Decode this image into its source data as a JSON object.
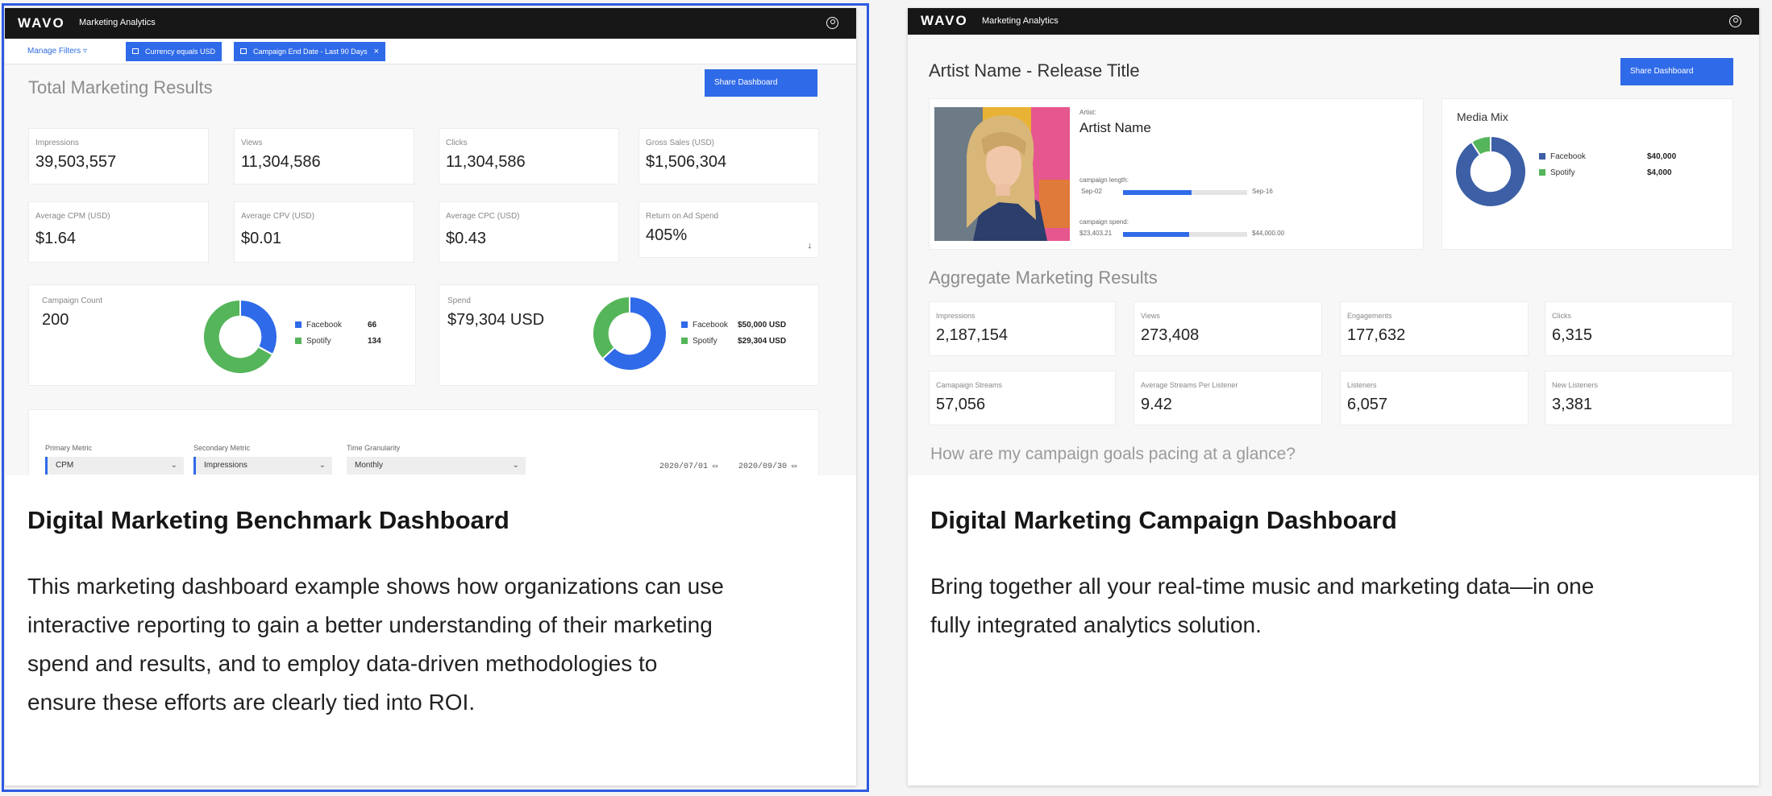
{
  "colors": {
    "accent": "#2f6ae8",
    "topbar": "#171717",
    "facebook": "#2f6ae8",
    "spotify": "#55b55a",
    "facebook_dark": "#3c5fa6"
  },
  "card1": {
    "topbar": {
      "logo": "WAVO",
      "app": "Marketing Analytics"
    },
    "filters": {
      "manage": "Manage Filters",
      "chip1": "Currency equals USD",
      "chip2": "Campaign End Date - Last 90 Days",
      "close": "×"
    },
    "title": "Total Marketing Results",
    "share": "Share Dashboard",
    "metrics": [
      {
        "label": "Impressions",
        "value": "39,503,557"
      },
      {
        "label": "Views",
        "value": "11,304,586"
      },
      {
        "label": "Clicks",
        "value": "11,304,586"
      },
      {
        "label": "Gross Sales (USD)",
        "value": "$1,506,304"
      },
      {
        "label": "Average CPM (USD)",
        "value": "$1.64"
      },
      {
        "label": "Average CPV (USD)",
        "value": "$0.01"
      },
      {
        "label": "Average CPC (USD)",
        "value": "$0.43"
      },
      {
        "label": "Return on Ad Spend",
        "value": "405%"
      }
    ],
    "roas_arrow": "↓",
    "campaign_count": {
      "label": "Campaign Count",
      "value": "200",
      "legend": [
        {
          "name": "Facebook",
          "value": "66"
        },
        {
          "name": "Spotify",
          "value": "134"
        }
      ],
      "slices": [
        66,
        134
      ]
    },
    "spend": {
      "label": "Spend",
      "value": "$79,304 USD",
      "legend": [
        {
          "name": "Facebook",
          "value": "$50,000 USD"
        },
        {
          "name": "Spotify",
          "value": "$29,304 USD"
        }
      ],
      "slices": [
        50000,
        29304
      ]
    },
    "selectors": {
      "primary_label": "Primary Metric",
      "primary_value": "CPM",
      "secondary_label": "Secondary Metric",
      "secondary_value": "Impressions",
      "time_label": "Time Granularity",
      "time_value": "Monthly",
      "date_start": "2020/07/01",
      "date_end": "2020/09/30"
    },
    "caption_title": "Digital Marketing Benchmark Dashboard",
    "caption_desc_lines": [
      "This marketing dashboard example shows how organizations can use",
      "interactive reporting to gain a better understanding of their marketing",
      "spend and results, and to employ data-driven methodologies to",
      "ensure these efforts are clearly tied into ROI."
    ]
  },
  "card2": {
    "topbar": {
      "logo": "WAVO",
      "app": "Marketing Analytics"
    },
    "title": "Artist Name - Release Title",
    "share": "Share Dashboard",
    "artist": {
      "label": "Artist:",
      "name": "Artist Name",
      "length_label": "campaign length:",
      "length_start": "Sep-02",
      "length_end": "Sep-16",
      "length_progress": 0.55,
      "spend_label": "campaign spend:",
      "spend_start": "$23,403.21",
      "spend_end": "$44,000.00",
      "spend_progress": 0.53
    },
    "media_mix": {
      "title": "Media Mix",
      "legend": [
        {
          "name": "Facebook",
          "value": "$40,000"
        },
        {
          "name": "Spotify",
          "value": "$4,000"
        }
      ],
      "slices": [
        40000,
        4000
      ]
    },
    "aggregate_title": "Aggregate Marketing Results",
    "metrics": [
      {
        "label": "Impressions",
        "value": "2,187,154"
      },
      {
        "label": "Views",
        "value": "273,408"
      },
      {
        "label": "Engagements",
        "value": "177,632"
      },
      {
        "label": "Clicks",
        "value": "6,315"
      },
      {
        "label": "Camapaign Streams",
        "value": "57,056"
      },
      {
        "label": "Average Streams Per Listener",
        "value": "9.42"
      },
      {
        "label": "Listeners",
        "value": "6,057"
      },
      {
        "label": "New Listeners",
        "value": "3,381"
      }
    ],
    "pacing_title": "How are my campaign goals pacing at a glance?",
    "caption_title": "Digital Marketing Campaign Dashboard",
    "caption_desc_lines": [
      "Bring together all your real-time music and marketing data—in one",
      "fully integrated analytics solution."
    ]
  }
}
